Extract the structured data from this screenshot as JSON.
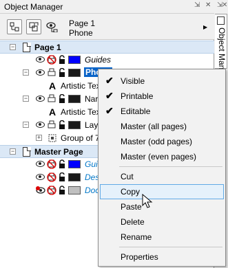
{
  "window": {
    "title": "Object Manager",
    "side_tab": "Object Manager"
  },
  "toolbar": {
    "page_name": "Page 1",
    "layer_name": "Phone"
  },
  "tree": {
    "page1": "Page 1",
    "guides": "Guides",
    "phone": "Phone",
    "artistic_text_1": "Artistic Tex",
    "name_layer": "Nar",
    "artistic_text_2": "Artistic Tex",
    "layer3": "Lay",
    "group": "Group of 7",
    "master_page": "Master Page",
    "m_guides": "Guid",
    "m_desktop": "Des",
    "m_doc_grid": "Doc"
  },
  "colors": {
    "guides": "#0000ff",
    "phone": "#1a1a1a",
    "name_layer": "#1a1a1a",
    "layer3": "#1a1a1a",
    "m_guides": "#0000ff",
    "m_desktop": "#1a1a1a",
    "m_doc_grid": "#c0c0c0",
    "selection": "#0a64c8",
    "header_bg": "#dbe8f6"
  },
  "context_menu": {
    "items": [
      {
        "label": "Visible",
        "checked": true
      },
      {
        "label": "Printable",
        "checked": true
      },
      {
        "label": "Editable",
        "checked": true
      },
      {
        "label": "Master (all pages)",
        "checked": false
      },
      {
        "label": "Master (odd pages)",
        "checked": false
      },
      {
        "label": "Master (even pages)",
        "checked": false
      },
      {
        "label": "Cut",
        "checked": false
      },
      {
        "label": "Copy",
        "checked": false,
        "highlighted": true
      },
      {
        "label": "Paste",
        "checked": false
      },
      {
        "label": "Delete",
        "checked": false
      },
      {
        "label": "Rename",
        "checked": false
      },
      {
        "label": "Properties",
        "checked": false
      }
    ]
  }
}
